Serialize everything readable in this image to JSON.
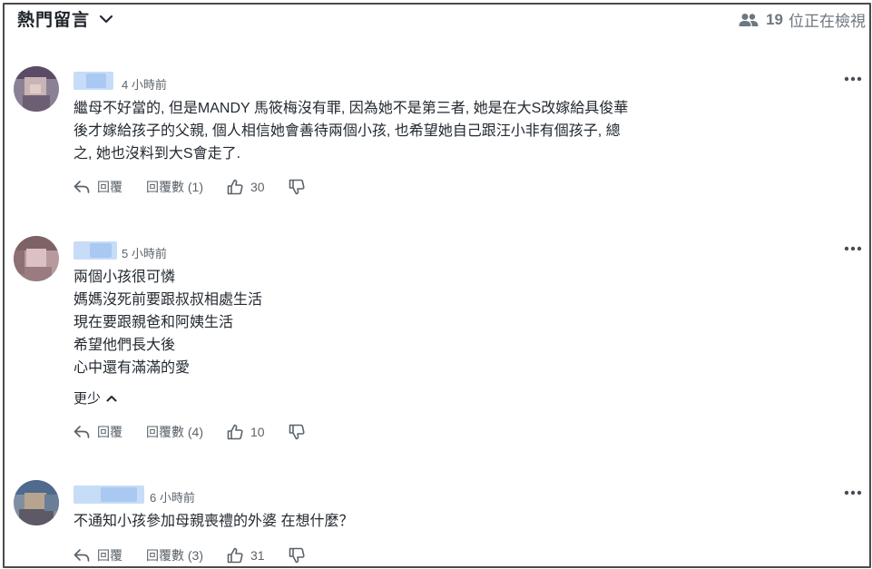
{
  "header": {
    "title": "熱門留言",
    "viewer_count": "19",
    "viewer_text": "位正在檢視"
  },
  "comments": [
    {
      "time": "4 小時前",
      "lines": [
        "繼母不好當的, 但是MANDY 馬筱梅沒有罪, 因為她不是第三者, 她是在大S改嫁給具俊華",
        "後才嫁給孩子的父親, 個人相信她會善待兩個小孩, 也希望她自己跟汪小非有個孩子, 總",
        "之, 她也沒料到大S會走了."
      ],
      "reply_label": "回覆",
      "replies_label": "回覆數 (1)",
      "likes": "30",
      "dislikes": ""
    },
    {
      "time": "5 小時前",
      "lines": [
        "兩個小孩很可憐",
        "媽媽沒死前要跟叔叔相處生活",
        "現在要跟親爸和阿姨生活",
        "希望他們長大後",
        "心中還有滿滿的愛"
      ],
      "show_less": "更少",
      "reply_label": "回覆",
      "replies_label": "回覆數 (4)",
      "likes": "10",
      "dislikes": ""
    },
    {
      "time": "6 小時前",
      "lines": [
        "不通知小孩參加母親喪禮的外婆 在想什麼？"
      ],
      "reply_label": "回覆",
      "replies_label": "回覆數 (3)",
      "likes": "31",
      "dislikes": ""
    }
  ],
  "icons": {
    "viewers": "people-icon",
    "header_chevron": "chevron-down-icon",
    "more": "more-horizontal-icon",
    "reply": "reply-arrow-icon",
    "like": "thumbs-up-icon",
    "dislike": "thumbs-down-icon",
    "show_less": "chevron-up-icon"
  },
  "colors": {
    "text": "#232a31",
    "muted": "#5b636a",
    "name_blur": "#a9c8f2",
    "border": "#4a4a4a"
  }
}
